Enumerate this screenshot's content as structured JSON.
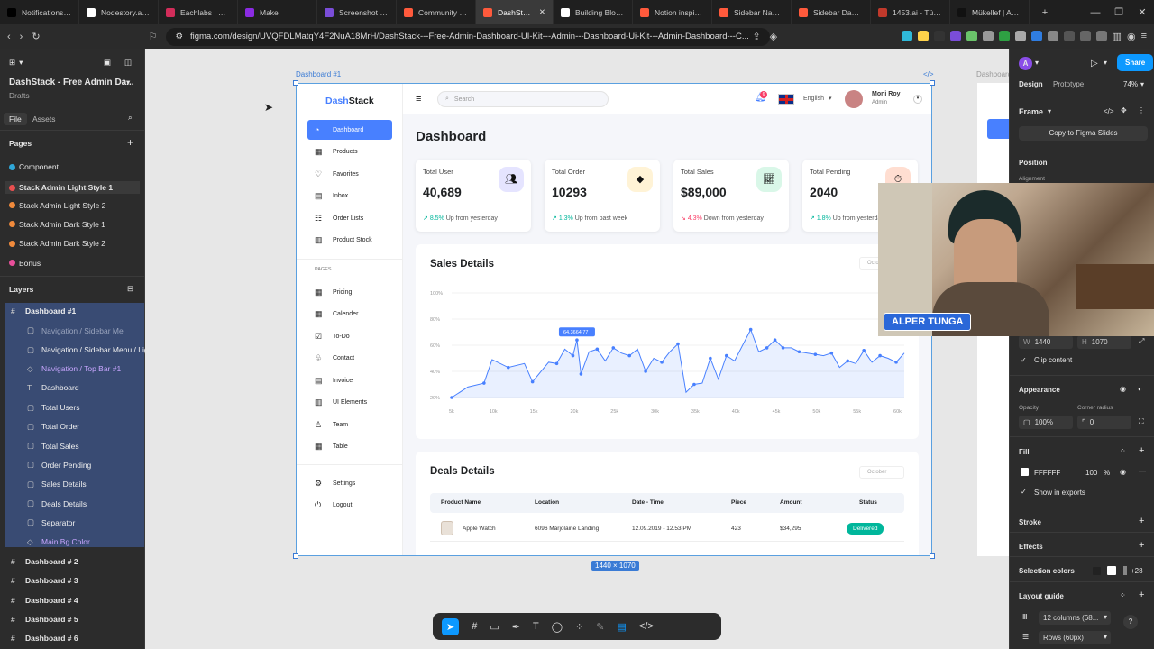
{
  "browser": {
    "tabs": [
      {
        "label": "Notifications / X",
        "color": "#000000"
      },
      {
        "label": "Nodestory.ai - ...",
        "color": "#ffffff"
      },
      {
        "label": "Eachlabs | Build",
        "color": "#d22d5a"
      },
      {
        "label": "Make",
        "color": "#8a2be2"
      },
      {
        "label": "Screenshot by ...",
        "color": "#7a4dd8"
      },
      {
        "label": "Community - F",
        "color": "#ff5a3c"
      },
      {
        "label": "DashStack",
        "color": "#ff5a3c",
        "active": true
      },
      {
        "label": "Building Blocks",
        "color": "#ffffff"
      },
      {
        "label": "Notion inspired",
        "color": "#ff5a3c"
      },
      {
        "label": "Sidebar Naviga...",
        "color": "#ff5a3c"
      },
      {
        "label": "Sidebar Dashbo...",
        "color": "#ff5a3c"
      },
      {
        "label": "1453.ai - Türk A",
        "color": "#c0392b"
      },
      {
        "label": "Mükellef | Ame...",
        "color": "#111111"
      }
    ],
    "url": "figma.com/design/UVQFDLMatqY4F2NuA18MrH/DashStack---Free-Admin-Dashboard-UI-Kit---Admin---Dashboard-Ui-Kit---Admin-Dashboard---C...",
    "new_tab": "+",
    "min": "—",
    "max": "❐",
    "close": "✕"
  },
  "figma_left": {
    "file_title": "DashStack - Free Admin Da...",
    "drafts": "Drafts",
    "tab_file": "File",
    "tab_assets": "Assets",
    "pages_header": "Pages",
    "pages": [
      {
        "label": "Component",
        "color": "#2fa7d8"
      },
      {
        "label": "Stack Admin Light Style 1",
        "color": "#e84f4f"
      },
      {
        "label": "Stack Admin Light Style 2",
        "color": "#f08a3c"
      },
      {
        "label": "Stack Admin Dark Style 1",
        "color": "#f08a3c"
      },
      {
        "label": "Stack Admin Dark Style 2",
        "color": "#f08a3c"
      },
      {
        "label": "Bonus",
        "color": "#e84f9a"
      }
    ],
    "layers_header": "Layers",
    "layers": [
      {
        "label": "Dashboard  #1",
        "bold": true
      },
      {
        "label": "Navigation / Sidebar Me",
        "dim": true
      },
      {
        "label": "Navigation / Sidebar Menu / Light"
      },
      {
        "label": "Navigation / Top Bar #1",
        "purple": true
      },
      {
        "label": "Dashboard"
      },
      {
        "label": "Total Users"
      },
      {
        "label": "Total Order"
      },
      {
        "label": "Total Sales"
      },
      {
        "label": "Order Pending"
      },
      {
        "label": "Sales Details"
      },
      {
        "label": "Deals Details"
      },
      {
        "label": "Separator"
      },
      {
        "label": "Main Bg Color",
        "purple": true
      }
    ],
    "other_frames": [
      "Dashboard  # 2",
      "Dashboard  # 3",
      "Dashboard  # 4",
      "Dashboard  # 5",
      "Dashboard  # 6"
    ]
  },
  "canvas": {
    "frame_label": "Dashboard  #1",
    "size_badge": "1440 × 1070",
    "side_label": "Dashboard"
  },
  "dashboard": {
    "logo_a": "Dash",
    "logo_b": "Stack",
    "search_placeholder": "Search",
    "notif_count": "6",
    "language": "English",
    "user_name": "Moni Roy",
    "user_role": "Admin",
    "title": "Dashboard",
    "nav": [
      "Dashboard",
      "Products",
      "Favorites",
      "Inbox",
      "Order Lists",
      "Product Stock"
    ],
    "pages_label": "PAGES",
    "nav2": [
      "Pricing",
      "Calender",
      "To-Do",
      "Contact",
      "Invoice",
      "UI Elements",
      "Team",
      "Table"
    ],
    "nav3": [
      "Settings",
      "Logout"
    ],
    "cards": [
      {
        "title": "Total User",
        "value": "40,689",
        "pct": "8.5%",
        "text": "Up from yesterday",
        "up": true,
        "iconbg": "#e5e4ff"
      },
      {
        "title": "Total Order",
        "value": "10293",
        "pct": "1.3%",
        "text": "Up from past week",
        "up": true,
        "iconbg": "#fff3d6"
      },
      {
        "title": "Total Sales",
        "value": "$89,000",
        "pct": "4.3%",
        "text": "Down from yesterday",
        "up": false,
        "iconbg": "#d9f7e8"
      },
      {
        "title": "Total Pending",
        "value": "2040",
        "pct": "1.8%",
        "text": "Up from yesterday",
        "up": true,
        "iconbg": "#ffded1"
      }
    ],
    "sales_title": "Sales Details",
    "month": "October",
    "chart_data": {
      "type": "area",
      "title": "Sales Details",
      "x_ticks": [
        "5k",
        "10k",
        "15k",
        "20k",
        "25k",
        "30k",
        "35k",
        "40k",
        "45k",
        "50k",
        "55k",
        "60k"
      ],
      "y_ticks": [
        "20%",
        "40%",
        "60%",
        "80%",
        "100%"
      ],
      "ylim": [
        20,
        100
      ],
      "x": [
        5,
        7,
        9,
        10,
        12,
        14,
        15,
        17,
        18,
        19,
        20,
        20.5,
        21,
        22,
        23,
        24,
        25,
        26,
        27,
        28,
        29,
        30,
        31,
        32,
        33,
        34,
        35,
        36,
        37,
        38,
        39,
        40,
        42,
        43,
        44,
        45,
        46,
        47,
        48,
        49,
        50,
        51,
        52,
        53,
        54,
        55,
        56,
        57,
        58,
        59,
        60,
        61
      ],
      "y": [
        20,
        28,
        31,
        49,
        43,
        46,
        32,
        47,
        46,
        57,
        52,
        64,
        38,
        55,
        57,
        48,
        58,
        54,
        52,
        57,
        40,
        50,
        47,
        55,
        61,
        24,
        30,
        31,
        50,
        34,
        52,
        48,
        72,
        55,
        58,
        64,
        58,
        58,
        55,
        54,
        53,
        52,
        54,
        43,
        48,
        46,
        56,
        47,
        52,
        50,
        47,
        54
      ],
      "tooltip": "64,3664.77",
      "grid": true
    },
    "deals_title": "Deals Details",
    "deals_month": "October",
    "table_headers": [
      "Product Name",
      "Location",
      "Date - Time",
      "Piece",
      "Amount",
      "Status"
    ],
    "table_rows": [
      {
        "product": "Apple Watch",
        "location": "6096 Marjolaine Landing",
        "date": "12.09.2019 - 12.53 PM",
        "piece": "423",
        "amount": "$34,295",
        "status": "Delivered"
      }
    ]
  },
  "figma_right": {
    "avatar": "A",
    "share": "Share",
    "tab_design": "Design",
    "tab_prototype": "Prototype",
    "zoom": "74%",
    "frame_label": "Frame",
    "copy_slides": "Copy to Figma Slides",
    "position": "Position",
    "alignment": "Alignment",
    "w_label": "W",
    "w_val": "1440",
    "h_label": "H",
    "h_val": "1070",
    "clip": "Clip content",
    "appearance": "Appearance",
    "opacity_label": "Opacity",
    "opacity": "100%",
    "radius_label": "Corner radius",
    "radius": "0",
    "fill": "Fill",
    "fill_hex": "FFFFFF",
    "fill_pct": "100",
    "pct": "%",
    "show_exports": "Show in exports",
    "stroke": "Stroke",
    "effects": "Effects",
    "sel_colors": "Selection colors",
    "more_colors": "+28",
    "layout_guide": "Layout guide",
    "columns": "12 columns (68...",
    "rows": "Rows (60px)"
  },
  "webcam": {
    "name": "ALPER TUNGA"
  }
}
